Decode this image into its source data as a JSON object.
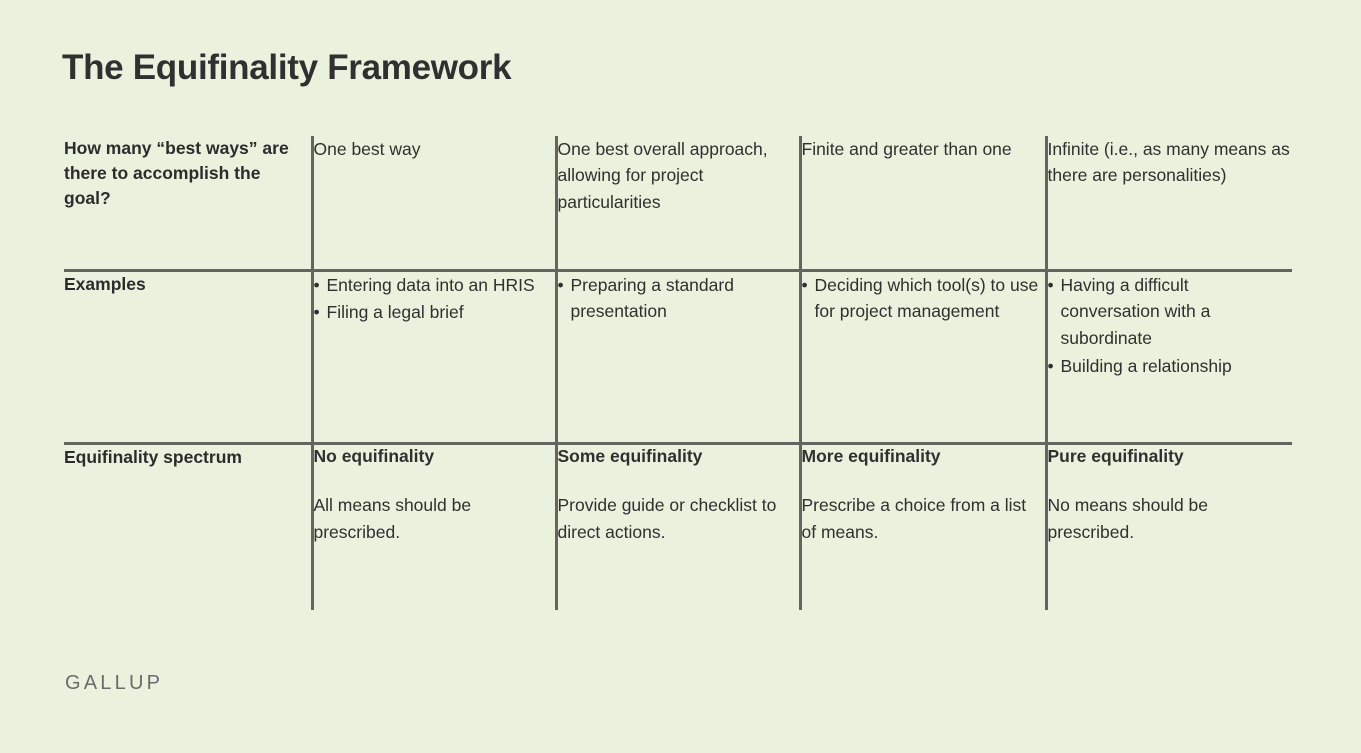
{
  "page": {
    "title": "The Equifinality Framework",
    "footer_logo": "GALLUP",
    "background_color": "#eaf2dd",
    "accent_green": "#63b850",
    "rule_color": "#63655f",
    "text_color": "#2e3130"
  },
  "table": {
    "rows": [
      {
        "label": "How many “best ways” are there to accomplish the goal?",
        "cells": [
          {
            "type": "text",
            "text": "One best way"
          },
          {
            "type": "text",
            "text": "One best overall approach, allowing for project particularities"
          },
          {
            "type": "text",
            "text": "Finite and greater than one"
          },
          {
            "type": "text",
            "text": "Infinite (i.e., as many means as there are personalities)"
          }
        ]
      },
      {
        "label": "Examples",
        "cells": [
          {
            "type": "bullets",
            "items": [
              "Entering data into an HRIS",
              "Filing a legal brief"
            ]
          },
          {
            "type": "bullets",
            "items": [
              "Preparing a standard presentation"
            ]
          },
          {
            "type": "bullets",
            "items": [
              "Deciding which tool(s) to use for project management"
            ]
          },
          {
            "type": "bullets",
            "items": [
              "Having a difficult conversation with a subordinate",
              "Building a relationship"
            ]
          }
        ]
      },
      {
        "label": "Equifinality spectrum",
        "cells": [
          {
            "type": "heading_body",
            "heading": "No equifinality",
            "body": "All means should be prescribed."
          },
          {
            "type": "heading_body",
            "heading": "Some equifinality",
            "body": "Provide guide or checklist to direct actions."
          },
          {
            "type": "heading_body",
            "heading": "More equifinality",
            "body": "Prescribe a choice from a list of means."
          },
          {
            "type": "heading_body",
            "heading": "Pure equifinality",
            "body": "No means should be prescribed."
          }
        ]
      }
    ]
  }
}
